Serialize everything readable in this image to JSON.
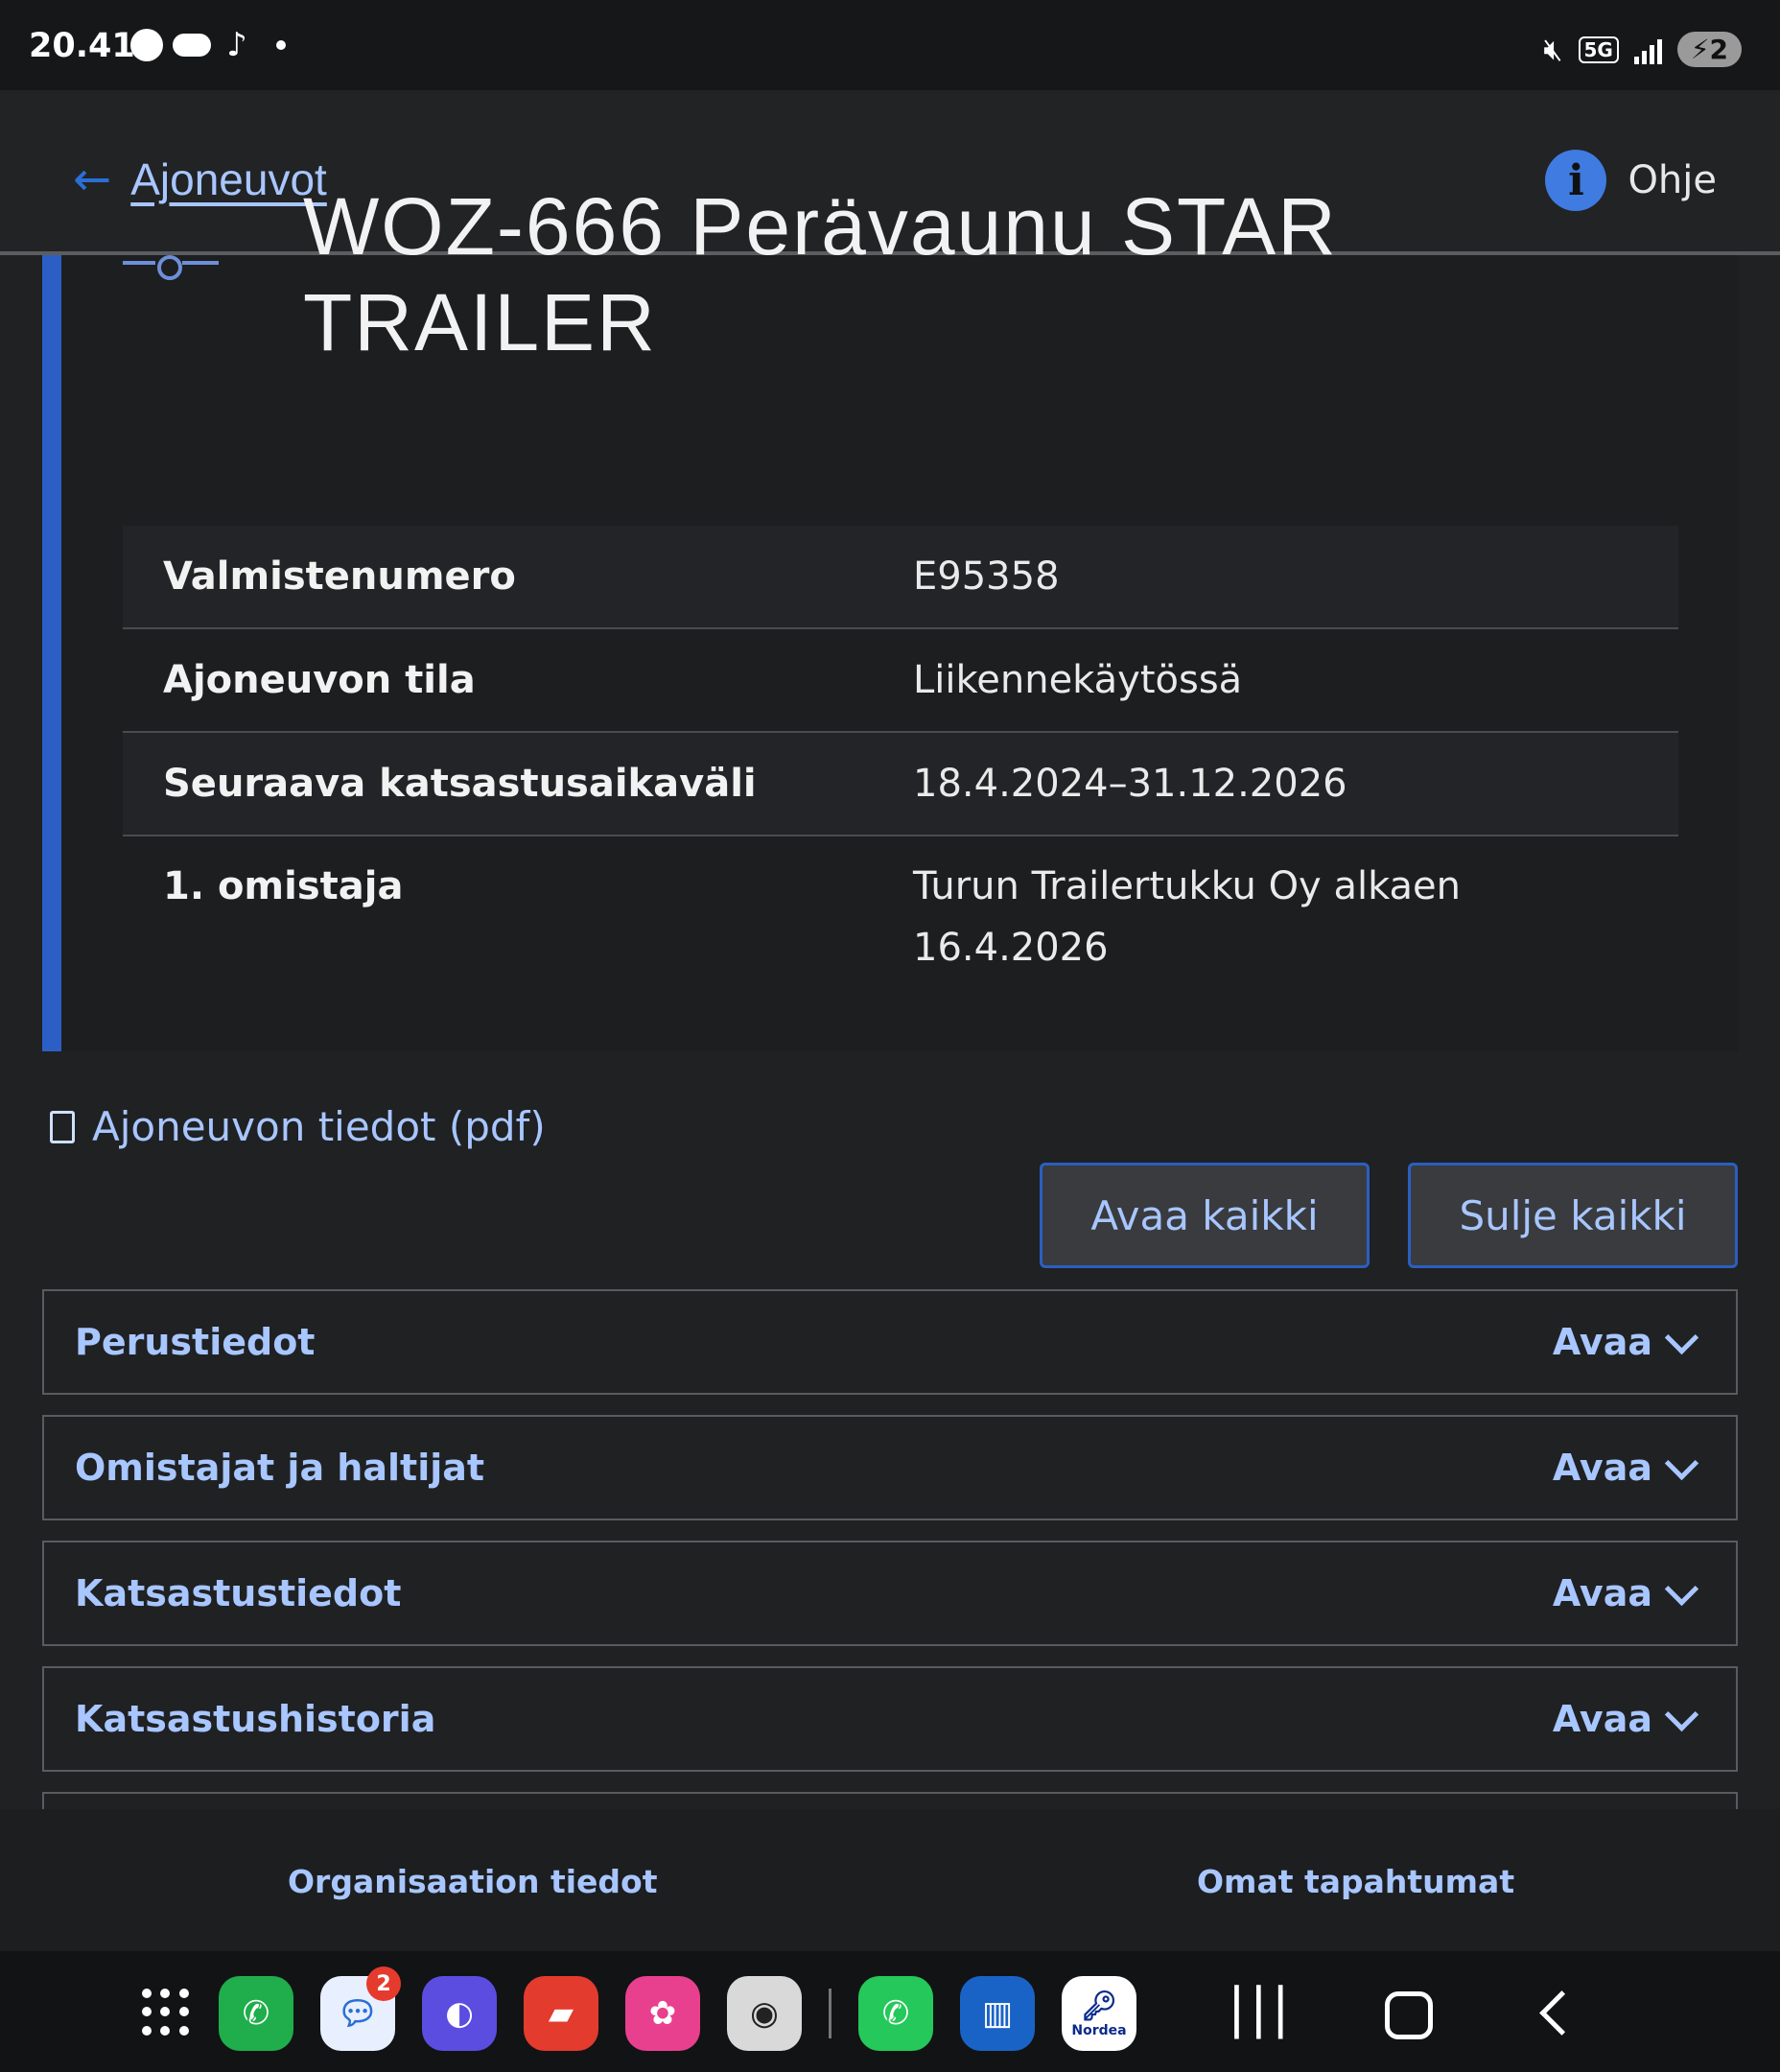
{
  "status_bar": {
    "time": "20.41",
    "network": "5G",
    "battery": "2",
    "icons": [
      "facebook-icon",
      "cloud-icon",
      "tiktok-icon",
      "mute-icon",
      "signal-icon"
    ]
  },
  "header": {
    "back_label": "Ajoneuvot",
    "help_label": "Ohje"
  },
  "vehicle": {
    "title_line1": "WOZ-666 Perävaunu STAR",
    "title_line2": "TRAILER",
    "rows": [
      {
        "label": "Valmistenumero",
        "value": "E95358"
      },
      {
        "label": "Ajoneuvon tila",
        "value": "Liikennekäytössä"
      },
      {
        "label": "Seuraava katsastusaikaväli",
        "value": "18.4.2024–31.12.2026"
      },
      {
        "label": "1. omistaja",
        "value": "Turun Trailertukku Oy alkaen 16.4.2026"
      }
    ]
  },
  "pdf_link": "Ajoneuvon tiedot (pdf)",
  "buttons": {
    "open_all": "Avaa kaikki",
    "close_all": "Sulje kaikki"
  },
  "sections": [
    {
      "title": "Perustiedot",
      "toggle": "Avaa"
    },
    {
      "title": "Omistajat ja haltijat",
      "toggle": "Avaa"
    },
    {
      "title": "Katsastustiedot",
      "toggle": "Avaa"
    },
    {
      "title": "Katsastushistoria",
      "toggle": "Avaa"
    }
  ],
  "bottom_nav": {
    "org": "Organisaation tiedot",
    "own": "Omat tapahtumat"
  },
  "dock": {
    "messages_badge": "2",
    "nordea_label": "Nordea",
    "colors": {
      "phone": "#1fae4b",
      "messages": "#e8f0ff",
      "browser": "#5b4de0",
      "notes": "#e33b2d",
      "gallery": "#e8408e",
      "camera": "#d9d9d9",
      "whatsapp": "#25c85a",
      "trello": "#1a63c6",
      "nordea": "#ffffff"
    }
  }
}
